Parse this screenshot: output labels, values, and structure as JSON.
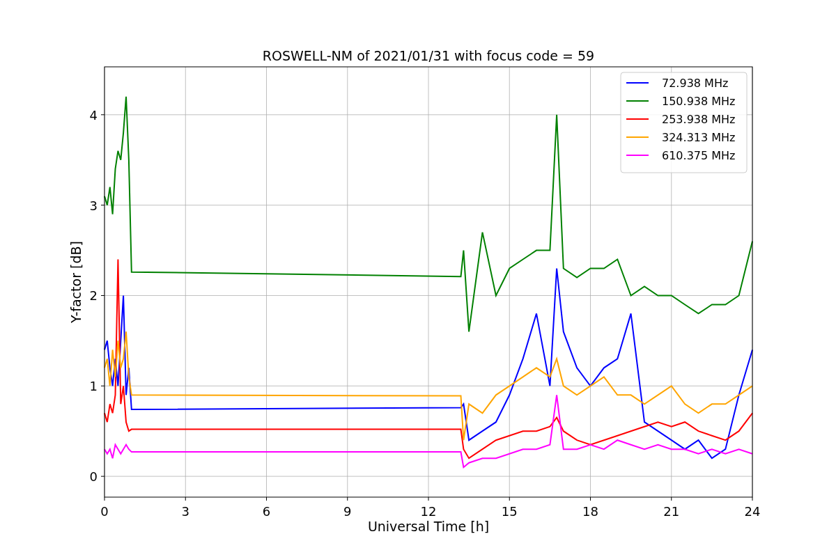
{
  "chart_data": {
    "type": "line",
    "title": "ROSWELL-NM of 2021/01/31 with focus code = 59",
    "xlabel": "Universal Time [h]",
    "ylabel": "Y-factor [dB]",
    "x": [
      0,
      0.1,
      0.2,
      0.3,
      0.4,
      0.5,
      0.6,
      0.7,
      0.8,
      0.9,
      1.0,
      13.2,
      13.3,
      13.5,
      14,
      14.5,
      15,
      15.5,
      16,
      16.5,
      16.75,
      17,
      17.5,
      18,
      18.5,
      19,
      19.5,
      20,
      20.5,
      21,
      21.5,
      22,
      22.5,
      23,
      23.5,
      24
    ],
    "series": [
      {
        "name": "72.938 MHz",
        "color": "#0000ff",
        "values": [
          1.4,
          1.5,
          1.2,
          1.0,
          1.3,
          1.0,
          1.5,
          2.0,
          0.9,
          1.2,
          0.74,
          0.76,
          0.8,
          0.4,
          0.5,
          0.6,
          0.9,
          1.3,
          1.8,
          1.0,
          2.3,
          1.6,
          1.2,
          1.0,
          1.2,
          1.3,
          1.8,
          0.6,
          0.5,
          0.4,
          0.3,
          0.4,
          0.2,
          0.3,
          0.9,
          1.4
        ]
      },
      {
        "name": "150.938 MHz",
        "color": "#008000",
        "values": [
          3.1,
          3.0,
          3.2,
          2.9,
          3.4,
          3.6,
          3.5,
          3.8,
          4.2,
          3.5,
          2.26,
          2.21,
          2.5,
          1.6,
          2.7,
          2.0,
          2.3,
          2.4,
          2.5,
          2.5,
          4.0,
          2.3,
          2.2,
          2.3,
          2.3,
          2.4,
          2.0,
          2.1,
          2.0,
          2.0,
          1.9,
          1.8,
          1.9,
          1.9,
          2.0,
          2.6
        ]
      },
      {
        "name": "253.938 MHz",
        "color": "#ff0000",
        "values": [
          0.7,
          0.6,
          0.8,
          0.7,
          0.9,
          2.4,
          0.8,
          1.0,
          0.6,
          0.5,
          0.52,
          0.52,
          0.3,
          0.2,
          0.3,
          0.4,
          0.45,
          0.5,
          0.5,
          0.55,
          0.65,
          0.5,
          0.4,
          0.35,
          0.4,
          0.45,
          0.5,
          0.55,
          0.6,
          0.55,
          0.6,
          0.5,
          0.45,
          0.4,
          0.5,
          0.7
        ]
      },
      {
        "name": "324.313 MHz",
        "color": "#ffa500",
        "values": [
          1.2,
          1.3,
          1.0,
          1.4,
          1.1,
          1.5,
          1.2,
          1.3,
          1.6,
          1.1,
          0.9,
          0.89,
          0.4,
          0.8,
          0.7,
          0.9,
          1.0,
          1.1,
          1.2,
          1.1,
          1.3,
          1.0,
          0.9,
          1.0,
          1.1,
          0.9,
          0.9,
          0.8,
          0.9,
          1.0,
          0.8,
          0.7,
          0.8,
          0.8,
          0.9,
          1.0
        ]
      },
      {
        "name": "610.375 MHz",
        "color": "#ff00ff",
        "values": [
          0.3,
          0.25,
          0.3,
          0.2,
          0.35,
          0.3,
          0.25,
          0.3,
          0.35,
          0.3,
          0.27,
          0.27,
          0.1,
          0.15,
          0.2,
          0.2,
          0.25,
          0.3,
          0.3,
          0.35,
          0.9,
          0.3,
          0.3,
          0.35,
          0.3,
          0.4,
          0.35,
          0.3,
          0.35,
          0.3,
          0.3,
          0.25,
          0.3,
          0.25,
          0.3,
          0.25
        ]
      }
    ],
    "xlim": [
      0,
      24
    ],
    "ylim": [
      -0.23,
      4.53
    ],
    "xticks": [
      0,
      3,
      6,
      9,
      12,
      15,
      18,
      21,
      24
    ],
    "yticks": [
      0,
      1,
      2,
      3,
      4
    ],
    "grid": true,
    "legend": true
  }
}
